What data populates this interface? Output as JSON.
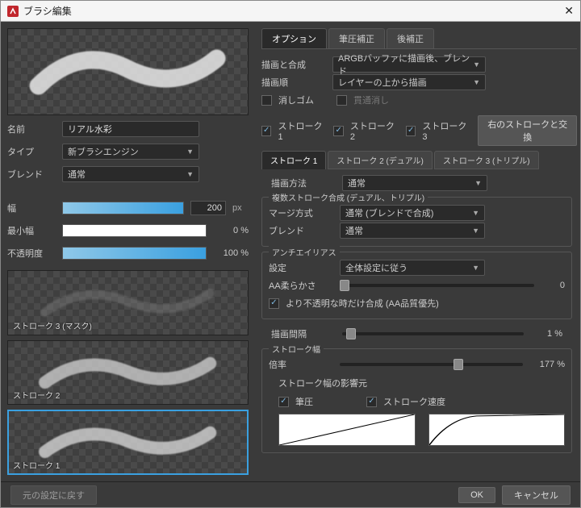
{
  "window": {
    "title": "ブラシ編集"
  },
  "left": {
    "name_label": "名前",
    "name_value": "リアル水彩",
    "type_label": "タイプ",
    "type_value": "新ブラシエンジン",
    "blend_label": "ブレンド",
    "blend_value": "通常",
    "width_label": "幅",
    "width_value": "200",
    "width_unit": "px",
    "minwidth_label": "最小幅",
    "minwidth_value": "0 %",
    "opacity_label": "不透明度",
    "opacity_value": "100 %",
    "preview_labels": {
      "stroke3": "ストローク 3 (マスク)",
      "stroke2": "ストローク 2",
      "stroke1": "ストローク 1"
    }
  },
  "right": {
    "tabs": {
      "options": "オプション",
      "pressure": "筆圧補正",
      "postcorr": "後補正"
    },
    "draw_comp_label": "描画と合成",
    "draw_comp_value": "ARGBバッファに描画後、ブレンド",
    "draw_order_label": "描画順",
    "draw_order_value": "レイヤーの上から描画",
    "eraser_label": "消しゴム",
    "through_label": "貫通消し",
    "stroke1_cb": "ストローク 1",
    "stroke2_cb": "ストローク 2",
    "stroke3_cb": "ストローク 3",
    "swap_btn": "右のストロークと交換",
    "stroke_tabs": {
      "s1": "ストローク 1",
      "s2": "ストローク 2 (デュアル)",
      "s3": "ストローク 3 (トリプル)"
    },
    "draw_method_label": "描画方法",
    "draw_method_value": "通常",
    "multi": {
      "legend": "複数ストローク合成 (デュアル、トリプル)",
      "merge_label": "マージ方式",
      "merge_value": "通常 (ブレンドで合成)",
      "blend_label": "ブレンド",
      "blend_value": "通常"
    },
    "aa": {
      "legend": "アンチエイリアス",
      "setting_label": "設定",
      "setting_value": "全体設定に従う",
      "soft_label": "AA柔らかさ",
      "soft_value": "0",
      "opaque_only_label": "より不透明な時だけ合成 (AA品質優先)"
    },
    "interval_label": "描画間隔",
    "interval_value": "1 %",
    "strokewidth": {
      "legend": "ストローク幅",
      "ratio_label": "倍率",
      "ratio_value": "177 %",
      "influence_label": "ストローク幅の影響元",
      "pressure_label": "筆圧",
      "speed_label": "ストローク速度"
    }
  },
  "footer": {
    "reset": "元の設定に戻す",
    "ok": "OK",
    "cancel": "キャンセル"
  }
}
